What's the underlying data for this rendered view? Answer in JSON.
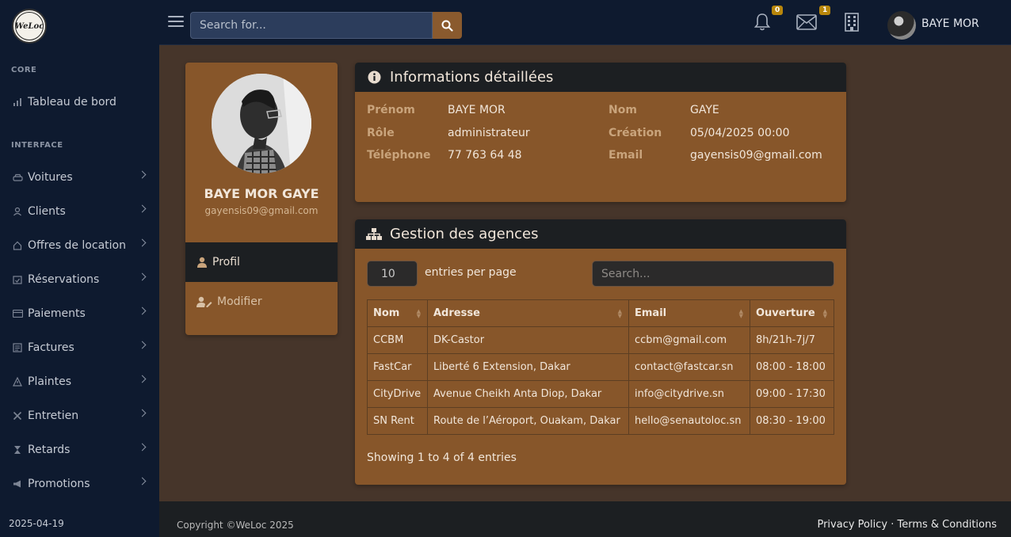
{
  "brand": {
    "logo_text": "WeLoc"
  },
  "sidebar": {
    "sections": [
      {
        "heading": "CORE"
      },
      {
        "heading": "INTERFACE"
      }
    ],
    "items": [
      {
        "label": "Tableau de bord",
        "icon": "bar-chart-icon"
      },
      {
        "label": "Voitures",
        "icon": "car-icon"
      },
      {
        "label": "Clients",
        "icon": "user-icon"
      },
      {
        "label": "Offres de location",
        "icon": "home-icon"
      },
      {
        "label": "Réservations",
        "icon": "calendar-check-icon"
      },
      {
        "label": "Paiements",
        "icon": "credit-card-icon"
      },
      {
        "label": "Factures",
        "icon": "invoice-icon"
      },
      {
        "label": "Plaintes",
        "icon": "warning-icon"
      },
      {
        "label": "Entretien",
        "icon": "tools-icon"
      },
      {
        "label": "Retards",
        "icon": "hourglass-icon"
      },
      {
        "label": "Promotions",
        "icon": "megaphone-icon"
      }
    ],
    "date": "2025-04-19"
  },
  "topbar": {
    "search_placeholder": "Search for...",
    "notifications_count": "0",
    "messages_count": "1",
    "user_name": "BAYE MOR"
  },
  "profile": {
    "name": "BAYE MOR GAYE",
    "email": "gayensis09@gmail.com",
    "nav_profil": "Profil",
    "nav_modifier": "Modifier"
  },
  "details": {
    "title": "Informations détaillées",
    "fields": {
      "prenom_label": "Prénom",
      "prenom_value": "BAYE MOR",
      "nom_label": "Nom",
      "nom_value": "GAYE",
      "role_label": "Rôle",
      "role_value": "administrateur",
      "creation_label": "Création",
      "creation_value": "05/04/2025 00:00",
      "telephone_label": "Téléphone",
      "telephone_value": "77 763 64 48",
      "email_label": "Email",
      "email_value": "gayensis09@gmail.com"
    }
  },
  "agencies": {
    "title": "Gestion des agences",
    "entries_value": "10",
    "entries_label": "entries per page",
    "search_placeholder": "Search...",
    "columns": [
      "Nom",
      "Adresse",
      "Email",
      "Ouverture"
    ],
    "rows": [
      [
        "CCBM",
        "DK-Castor",
        "ccbm@gmail.com",
        "8h/21h-7j/7"
      ],
      [
        "FastCar",
        "Liberté 6 Extension, Dakar",
        "contact@fastcar.sn",
        "08:00 - 18:00"
      ],
      [
        "CityDrive",
        "Avenue Cheikh Anta Diop, Dakar",
        "info@citydrive.sn",
        "09:00 - 17:30"
      ],
      [
        "SN Rent",
        "Route de l’Aéroport, Ouakam, Dakar",
        "hello@senautoloc.sn",
        "08:30 - 19:00"
      ]
    ],
    "showing": "Showing 1 to 4 of 4 entries"
  },
  "footer": {
    "copyright": "Copyright ©WeLoc 2025",
    "privacy": "Privacy Policy",
    "separator": "·",
    "terms": "Terms & Conditions"
  }
}
